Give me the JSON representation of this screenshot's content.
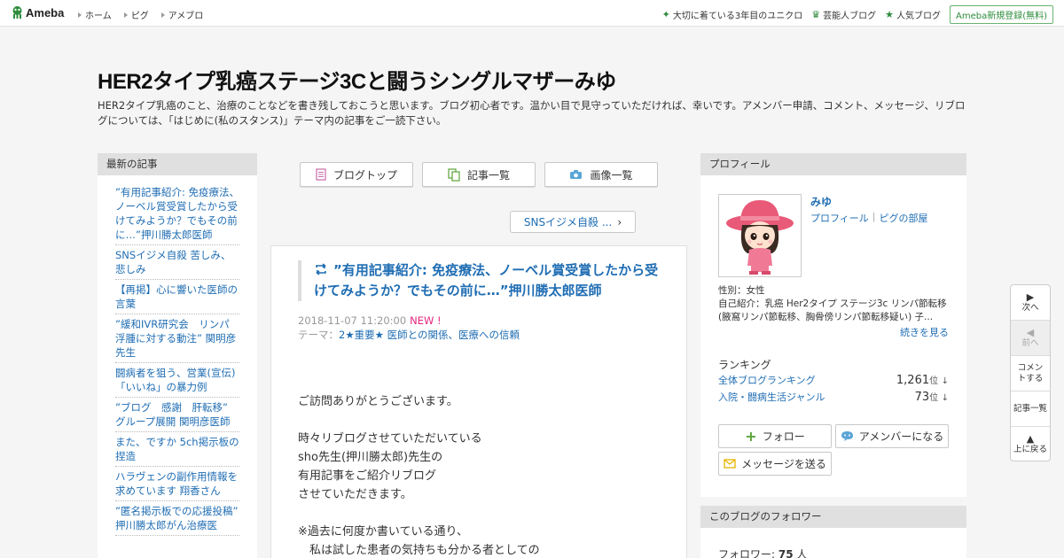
{
  "topbar": {
    "logo_text": "Ameba",
    "nav": [
      "ホーム",
      "ピグ",
      "アメブロ"
    ],
    "right_links": [
      {
        "label": "大切に着ている3年目のユニクロ",
        "icon": "sparkle-icon"
      },
      {
        "label": "芸能人ブログ",
        "icon": "crown-icon"
      },
      {
        "label": "人気ブログ",
        "icon": "star-icon"
      }
    ],
    "signup_label": "Ameba新規登録(無料)"
  },
  "header": {
    "title": "HER2タイプ乳癌ステージ3Cと闘うシングルマザーみゆ",
    "description": "HER2タイプ乳癌のこと、治療のことなどを書き残しておこうと思います。ブログ初心者です。温かい目で見守っていただければ、幸いです。アメンバー申請、コメント、メッセージ、リブログについては、「はじめに(私のスタンス)」テーマ内の記事をご一読下さい。"
  },
  "left_sidebar": {
    "heading": "最新の記事",
    "items": [
      "”有用記事紹介: 免疫療法、ノーベル賞受賞したから受けてみようか？でもその前に…”押川勝太郎医師",
      "SNSイジメ自殺 苦しみ、悲しみ",
      "【再掲】心に響いた医師の言葉",
      "”緩和IVR研究会　リンパ浮腫に対する動注” 関明彦先生",
      "闘病者を狙う、営業(宣伝)「いいね」の暴力例",
      "”ブログ　感謝　肝転移” グループ展開 関明彦医師",
      "また、ですか 5ch掲示板の捏造",
      "ハラヴェンの副作用情報を求めています 翔香さん",
      "”匿名掲示板での応援投稿” 押川勝太郎がん治療医"
    ]
  },
  "main": {
    "tabs": [
      {
        "label": "ブログトップ",
        "icon": "document-icon"
      },
      {
        "label": "記事一覧",
        "icon": "copy-icon"
      },
      {
        "label": "画像一覧",
        "icon": "camera-icon"
      }
    ],
    "next_article_label": "SNSイジメ自殺 ...",
    "article": {
      "title": "”有用記事紹介: 免疫療法、ノーベル賞受賞したから受けてみようか？でもその前に…”押川勝太郎医師",
      "date": "2018-11-07 11:20:00",
      "new_badge": "NEW !",
      "theme_label": "テーマ：",
      "theme": "2★重要★ 医師との関係、医療への信頼",
      "body": [
        "ご訪問ありがとうございます。",
        "",
        "時々リブログさせていただいている",
        "sho先生(押川勝太郎)先生の",
        "有用記事をご紹介リブログ",
        "させていただきます。",
        "",
        "※過去に何度か書いている通り、",
        "　私は試した患者の気持ちも分かる者としての"
      ]
    }
  },
  "right_sidebar": {
    "heading": "プロフィール",
    "name": "みゆ",
    "profile_link": "プロフィール",
    "pig_link": "ピグの部屋",
    "gender": "性別：女性",
    "intro": "自己紹介：乳癌 Her2タイプ ステージ3c リンパ節転移 (腋窩リンパ節転移、胸骨傍リンパ節転移疑い) 子...",
    "more_label": "続きを見る",
    "ranking_title": "ランキング",
    "rankings": [
      {
        "name": "全体ブログランキング",
        "value": "1,261",
        "unit": "位",
        "trend": "↓"
      },
      {
        "name": "入院・闘病生活ジャンル",
        "value": "73",
        "unit": "位",
        "trend": "↓"
      }
    ],
    "follow_label": "フォロー",
    "amember_label": "アメンバーになる",
    "message_label": "メッセージを送る",
    "followers_heading": "このブログのフォロワー",
    "followers_label": "フォロワー:",
    "followers_count": "75",
    "followers_unit": "人"
  },
  "float_nav": {
    "next": "次へ",
    "prev": "前へ",
    "comment": "コメントする",
    "list": "記事一覧",
    "top": "上に戻る"
  },
  "colors": {
    "link": "#1f6db3",
    "brand_green": "#2d8c3c",
    "new_pink": "#e8267e"
  }
}
